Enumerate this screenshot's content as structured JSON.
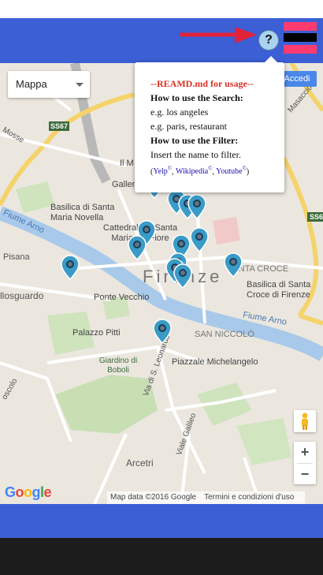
{
  "header": {
    "help_label": "?",
    "menu_colors": [
      "#ff3b6f",
      "#000000",
      "#ff3b6f"
    ]
  },
  "map": {
    "type_control": {
      "selected": "Mappa"
    },
    "sign_in": "Accedi",
    "labels": [
      {
        "text": "Firenze",
        "kind": "city"
      },
      {
        "text": "Basilica di Santa Maria Novella",
        "kind": "poi"
      },
      {
        "text": "Cattedrale di Santa Maria del Fiore",
        "kind": "poi"
      },
      {
        "text": "Basilica di Santa Croce di Firenze",
        "kind": "poi"
      },
      {
        "text": "Ponte Vecchio",
        "kind": "poi"
      },
      {
        "text": "Palazzo Pitti",
        "kind": "poi"
      },
      {
        "text": "Giardino di Boboli",
        "kind": "park"
      },
      {
        "text": "Piazzale Michelangelo",
        "kind": "poi"
      },
      {
        "text": "SANTA CROCE",
        "kind": "district"
      },
      {
        "text": "SAN NICCOLÒ",
        "kind": "district"
      },
      {
        "text": "Fiume Arno",
        "kind": "river"
      },
      {
        "text": "Fiume Arno",
        "kind": "river"
      },
      {
        "text": "Arcetri",
        "kind": "area"
      },
      {
        "text": "llosguardo",
        "kind": "area"
      },
      {
        "text": "Pisana",
        "kind": "road"
      },
      {
        "text": "Mosse",
        "kind": "road"
      },
      {
        "text": "Masaccio",
        "kind": "road"
      },
      {
        "text": "Galleri",
        "kind": "poi"
      },
      {
        "text": "Il M",
        "kind": "poi"
      },
      {
        "text": "Via di S. Leonardo",
        "kind": "road"
      },
      {
        "text": "Viale Galileo",
        "kind": "road"
      },
      {
        "text": "oscolo",
        "kind": "road"
      },
      {
        "text": "SS67",
        "kind": "shield"
      },
      {
        "text": "SS6",
        "kind": "shield"
      }
    ],
    "markers_count": 14,
    "attribution": {
      "data": "Map data ©2016 Google",
      "terms": "Termini e condizioni d'uso"
    },
    "google_logo": [
      "G",
      "o",
      "o",
      "g",
      "l",
      "e"
    ]
  },
  "popup": {
    "title": "--REAMD.md for usage--",
    "search_heading": "How to use the Search:",
    "search_example1": "e.g. los angeles",
    "search_example2": "e.g. paris, restaurant",
    "filter_heading": "How to use the Filter:",
    "filter_text": "Insert the name to filter.",
    "links_open": "(",
    "links_close": ")",
    "link_yelp": "Yelp",
    "link_wikipedia": "Wikipedia",
    "link_youtube": "Youtube",
    "sup": "©",
    "sep": ", "
  },
  "colors": {
    "header": "#3c5fd6",
    "marker": "#3a9bc7",
    "arrow": "#e0223a",
    "popup_title": "#d93025"
  }
}
